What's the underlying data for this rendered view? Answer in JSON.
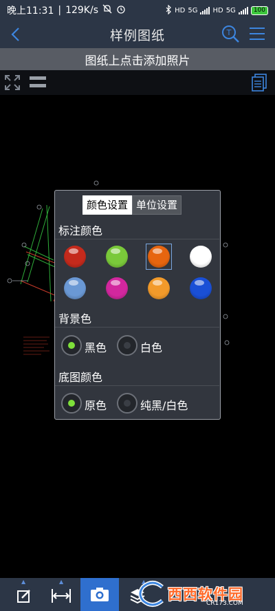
{
  "status": {
    "time": "晚上11:31",
    "speed": "129K/s",
    "net1": "HD",
    "net2": "5G",
    "net3": "HD",
    "net4": "5G",
    "battery": "100"
  },
  "header": {
    "title": "样例图纸"
  },
  "hint": "图纸上点击添加照片",
  "dialog": {
    "tabs": [
      {
        "label": "颜色设置",
        "active": true
      },
      {
        "label": "单位设置",
        "active": false
      }
    ],
    "annotation_color_label": "标注颜色",
    "colors": [
      "#c42a1c",
      "#7ac93a",
      "#e7650f",
      "#ffffff",
      "#6a98d4",
      "#d2279e",
      "#f29a2a",
      "#1a4fd6"
    ],
    "selected_color_index": 2,
    "background_label": "背景色",
    "background_options": [
      {
        "label": "黑色",
        "selected": true
      },
      {
        "label": "白色",
        "selected": false
      }
    ],
    "basemap_label": "底图颜色",
    "basemap_options": [
      {
        "label": "原色",
        "selected": true
      },
      {
        "label": "纯黑/白色",
        "selected": false
      }
    ]
  },
  "watermark": {
    "text": "西西软件园",
    "sub": "CR173.COM"
  },
  "accent": "#2f6fce"
}
